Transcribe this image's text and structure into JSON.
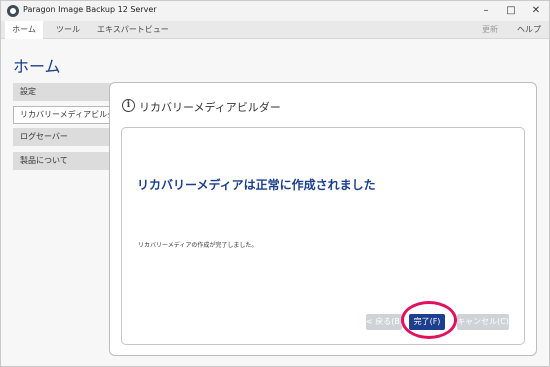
{
  "window": {
    "title": "Paragon Image Backup 12 Server",
    "min_glyph": "–",
    "max_glyph": "□",
    "close_glyph": "✕"
  },
  "menu": {
    "tabs": [
      "ホーム",
      "ツール",
      "エキスパートビュー"
    ],
    "active_tab": "ホーム",
    "update_label": "更新",
    "help_label": "ヘルプ"
  },
  "page": {
    "title": "ホーム"
  },
  "sidebar": {
    "items": [
      {
        "label": "設定"
      },
      {
        "label": "リカバリーメディアビルダー",
        "active": true
      },
      {
        "label": "ログセーバー"
      },
      {
        "label": "製品について"
      }
    ]
  },
  "panel": {
    "title": "リカバリーメディアビルダー",
    "info_glyph": "i",
    "heading": "リカバリーメディアは正常に作成されました",
    "detail": "リカバリーメディアの作成が完了しました。"
  },
  "buttons": {
    "back_label": "< 戻る(B)",
    "finish_label": "完了(F)",
    "cancel_label": "キャンセル(C)"
  },
  "colors": {
    "accent": "#1a3f8c",
    "highlight": "#e0115f",
    "disabled_button": "#cfd3d8"
  }
}
